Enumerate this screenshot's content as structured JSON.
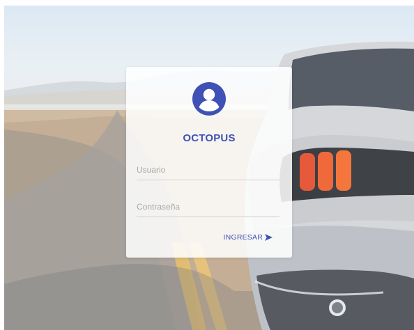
{
  "app": {
    "brand_name": "OCTOPUS",
    "accent_color": "#3f51b5"
  },
  "login_form": {
    "username_placeholder": "Usuario",
    "username_value": "",
    "password_placeholder": "Contraseña",
    "password_value": "",
    "submit_label": "INGRESAR",
    "submit_icon": "send-arrow-icon"
  },
  "icons": {
    "avatar": "account-circle-icon"
  },
  "background": {
    "description_color_sky": "#dfe9f1",
    "description_color_road": "#5d5e62"
  }
}
